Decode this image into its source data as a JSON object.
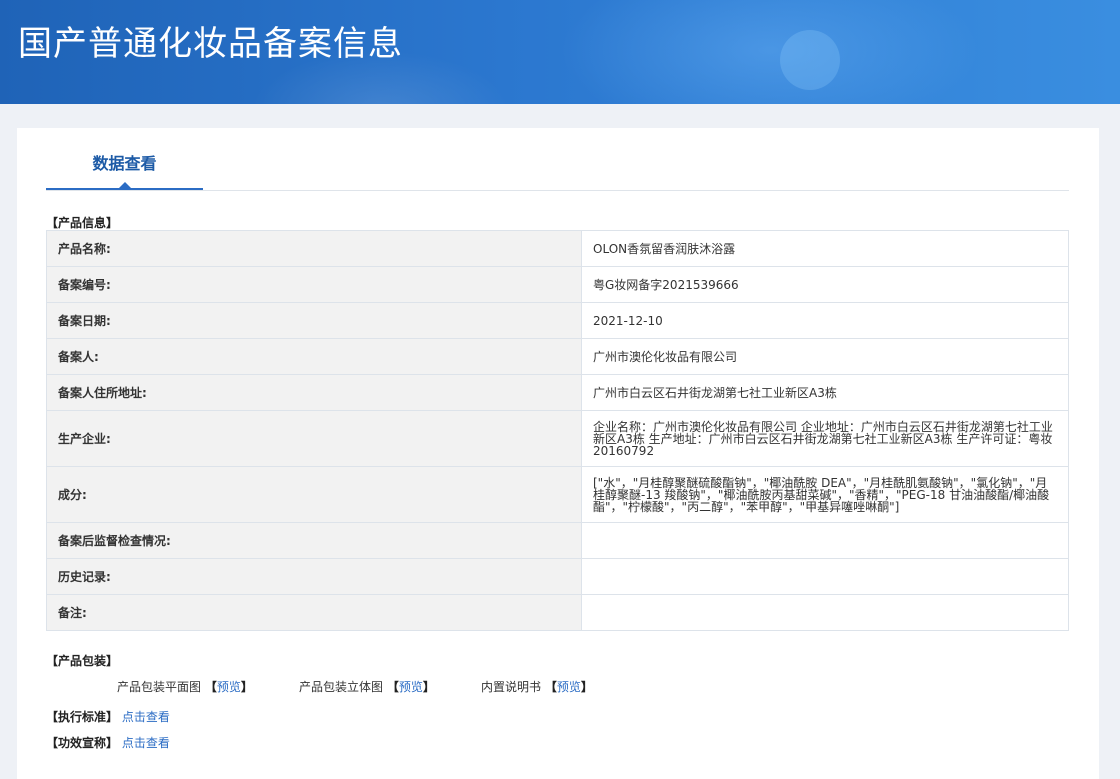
{
  "header": {
    "title": "国产普通化妆品备案信息"
  },
  "tabs": [
    {
      "label": "数据查看"
    }
  ],
  "product_info": {
    "section_label": "【产品信息】",
    "rows": [
      {
        "key": "产品名称:",
        "value": "OLON香氛留香润肤沐浴露"
      },
      {
        "key": "备案编号:",
        "value": "粤G妆网备字2021539666"
      },
      {
        "key": "备案日期:",
        "value": "2021-12-10"
      },
      {
        "key": "备案人:",
        "value": "广州市澳伦化妆品有限公司"
      },
      {
        "key": "备案人住所地址:",
        "value": "广州市白云区石井街龙湖第七社工业新区A3栋"
      },
      {
        "key": "生产企业:",
        "value": "企业名称：广州市澳伦化妆品有限公司 企业地址：广州市白云区石井街龙湖第七社工业新区A3栋 生产地址：广州市白云区石井街龙湖第七社工业新区A3栋 生产许可证：粤妆20160792"
      },
      {
        "key": "成分:",
        "value": "[\"水\"，\"月桂醇聚醚硫酸酯钠\"，\"椰油酰胺 DEA\"，\"月桂酰肌氨酸钠\"，\"氯化钠\"，\"月桂醇聚醚-13 羧酸钠\"，\"椰油酰胺丙基甜菜碱\"，\"香精\"，\"PEG-18 甘油油酸酯/椰油酸酯\"，\"柠檬酸\"，\"丙二醇\"，\"苯甲醇\"，\"甲基异噻唑啉酮\"]"
      },
      {
        "key": "备案后监督检查情况:",
        "value": ""
      },
      {
        "key": "历史记录:",
        "value": ""
      },
      {
        "key": "备注:",
        "value": ""
      }
    ]
  },
  "packaging": {
    "section_label": "【产品包装】",
    "items": [
      {
        "label": "产品包装平面图",
        "link": "预览"
      },
      {
        "label": "产品包装立体图",
        "link": "预览"
      },
      {
        "label": "内置说明书",
        "link": "预览"
      }
    ],
    "bracket_open": "【",
    "bracket_close": "】"
  },
  "standard": {
    "label": "【执行标准】",
    "link": "点击查看"
  },
  "efficacy": {
    "label": "【功效宣称】",
    "link": "点击查看"
  }
}
